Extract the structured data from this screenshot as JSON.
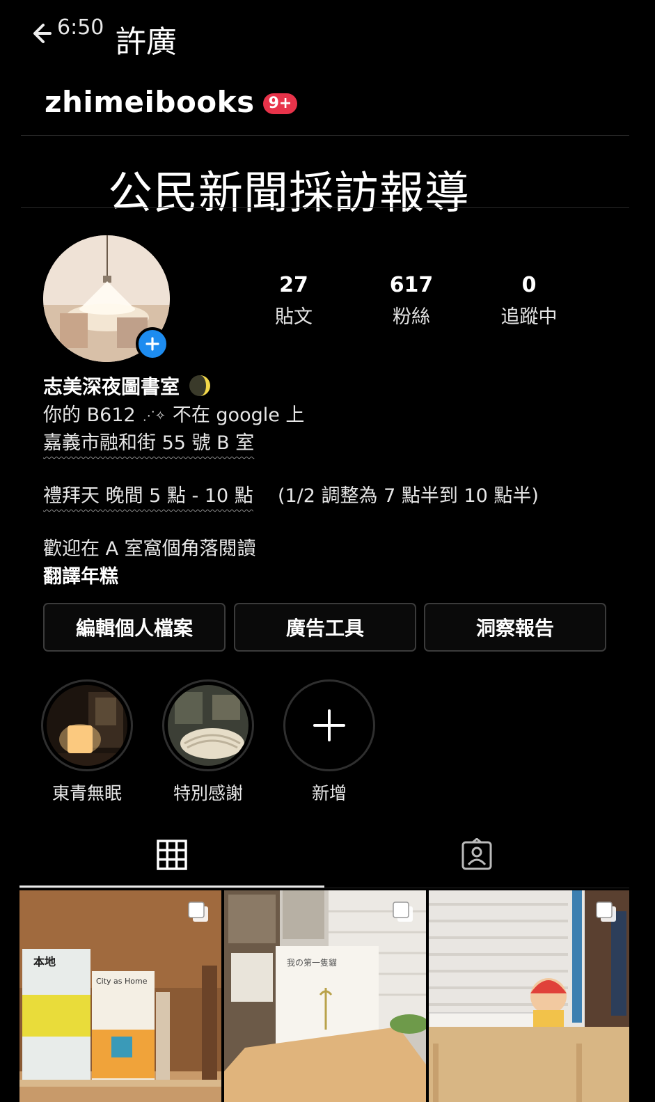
{
  "status": {
    "time": "6:50"
  },
  "caption_top": "許廣",
  "header": {
    "username": "zhimeibooks",
    "notification_badge": "9+"
  },
  "headline": "公民新聞採訪報導",
  "stats": [
    {
      "value": "27",
      "label": "貼文"
    },
    {
      "value": "617",
      "label": "粉絲"
    },
    {
      "value": "0",
      "label": "追蹤中"
    }
  ],
  "bio": {
    "name": "志美深夜圖書室",
    "line1_a": "你的 B612",
    "line1_b": "不在 google 上",
    "address": "嘉義市融和街 55 號 B 室",
    "hours_a": "禮拜天 晚間 5 點 - 10 點",
    "hours_b": "(1/2 調整為 7 點半到 10 點半)",
    "welcome": "歡迎在 A 室窩個角落閱讀",
    "translate": "翻譯年糕"
  },
  "buttons": {
    "edit_profile": "編輯個人檔案",
    "ad_tools": "廣告工具",
    "insights": "洞察報告"
  },
  "highlights": [
    {
      "label": "東青無眠"
    },
    {
      "label": "特別感謝"
    },
    {
      "label": "新增"
    }
  ],
  "posts": [
    {
      "book_title_1": "本地",
      "book_title_2": "City as Home"
    },
    {
      "book_title": "我の第一隻貓"
    },
    {}
  ],
  "colors": {
    "accent": "#1d8cf0",
    "badge": "#e8334a",
    "background": "#000000"
  },
  "icons": [
    "back-arrow-icon",
    "plus-icon",
    "moon-icon",
    "sparkle-icon",
    "grid-icon",
    "tagged-icon",
    "multiple-posts-icon"
  ]
}
